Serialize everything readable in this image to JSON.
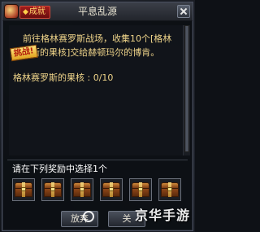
{
  "dialog": {
    "tag_label": "成就",
    "title": "平息乱源"
  },
  "quest": {
    "challenge_label": "挑战!",
    "description": "前往格林赛罗斯战场，收集10个[格林赛罗斯的果核]交给赫顿玛尔的博肯。",
    "progress_text": "格林赛罗斯的果核 : 0/10"
  },
  "rewards": {
    "prompt": "请在下列奖励中选择1个",
    "items": [
      {
        "icon": "treasure-chest-icon"
      },
      {
        "icon": "treasure-chest-icon"
      },
      {
        "icon": "treasure-chest-icon"
      },
      {
        "icon": "treasure-chest-icon"
      },
      {
        "icon": "treasure-chest-icon"
      },
      {
        "icon": "treasure-chest-icon"
      }
    ]
  },
  "buttons": {
    "abandon_label": "放弃",
    "accept_label": "关"
  },
  "watermark": {
    "text": "京华手游"
  },
  "colors": {
    "quest_text": "#f0d58a",
    "prompt_text": "#ffffff",
    "tag_red": "#a11d1d"
  }
}
